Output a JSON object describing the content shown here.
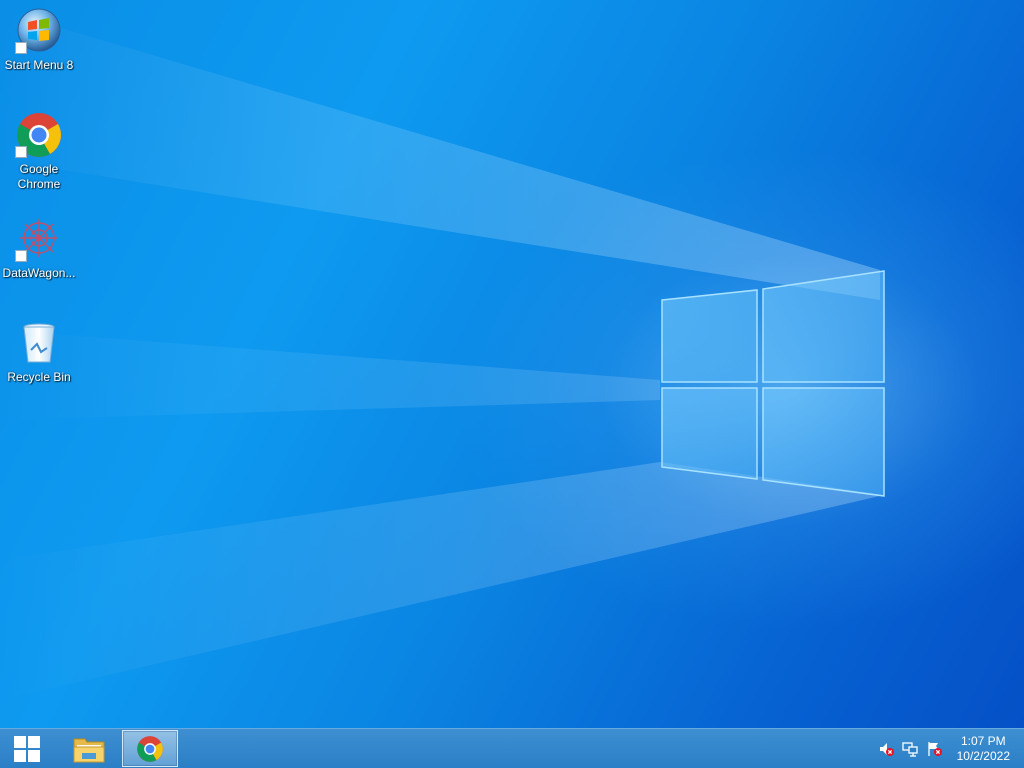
{
  "desktop": {
    "icons": [
      {
        "label": "Start Menu 8",
        "icon": "start-menu-8-orb-icon"
      },
      {
        "label": "Google Chrome",
        "icon": "chrome-icon"
      },
      {
        "label": "DataWagon...",
        "icon": "datawagon-icon"
      },
      {
        "label": "Recycle Bin",
        "icon": "recycle-bin-icon"
      }
    ],
    "colors": {
      "wallpaper_light": "#0e9af0",
      "wallpaper_dark": "#0550c6",
      "taskbar": "#2b7fc6"
    }
  },
  "taskbar": {
    "start_icon": "windows-start-icon",
    "pinned": [
      {
        "name": "File Explorer",
        "icon": "folder-icon",
        "active": false
      },
      {
        "name": "Google Chrome",
        "icon": "chrome-icon",
        "active": true
      }
    ],
    "tray": {
      "icons": [
        "volume-muted-icon",
        "network-icon",
        "action-center-flag-icon"
      ],
      "time": "1:07 PM",
      "date": "10/2/2022"
    }
  }
}
